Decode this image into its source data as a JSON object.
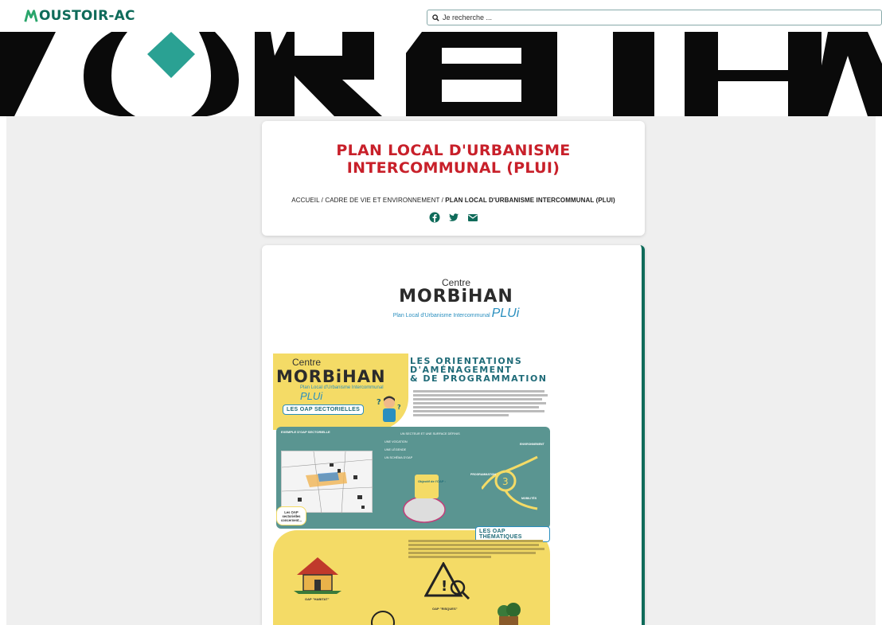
{
  "header": {
    "logo_text": "OUSTOIR-AC",
    "search_placeholder": "Je recherche ..."
  },
  "banner": {
    "text": "MORBIHA"
  },
  "page": {
    "title": "PLAN LOCAL D'URBANISME INTERCOMMUNAL (PLUI)",
    "breadcrumb": {
      "home": "ACCUEIL",
      "sep1": " / ",
      "section": "CADRE DE VIE ET ENVIRONNEMENT",
      "sep2": " / ",
      "current": "PLAN LOCAL D'URBANISME INTERCOMMUNAL (PLUI)"
    },
    "share_icons": [
      "facebook-icon",
      "twitter-icon",
      "email-icon"
    ]
  },
  "content": {
    "logo": {
      "line1": "Centre",
      "line2": "MORBiHAN",
      "line3": "Plan Local d'Urbanisme Intercommunal",
      "plui": "PLUi"
    },
    "poster": {
      "logo_line1": "Centre",
      "logo_line2": "MORBiHAN",
      "logo_line3": "Plan Local d'Urbanisme Intercommunal",
      "logo_plui": "PLUi",
      "title_line1": "LES ORIENTATIONS",
      "title_line2": "D'AMÉNAGEMENT",
      "title_line3": "& DE PROGRAMMATION",
      "tag_sectorielles": "LES OAP SECTORIELLES",
      "tag_thematiques": "LES OAP THÉMATIQUES",
      "label_exemple": "EXEMPLE D'OAP SECTORIELLE",
      "label_secteur": "UN SECTEUR ET UNE SURFACE DÉFINIS",
      "label_vocation": "UNE VOCATION",
      "label_legende": "UNE LÉGENDE",
      "label_schema": "UN SCHÉMA D'OAP",
      "label_objectif": "Objectif de l'OAP :",
      "label_environnement": "ENVIRONNEMENT",
      "label_programmation": "PROGRAMMATION",
      "label_mobilites": "MOBILITÉS",
      "label_concernent": "Les OAP sectorielles concernent...",
      "label_habitat": "OAP \"HABITAT\"",
      "label_risques": "OAP \"RISQUES\""
    }
  },
  "colors": {
    "brand_green": "#0f6b5a",
    "title_red": "#c8202a",
    "poster_yellow": "#f4db66",
    "poster_teal": "#5a9591",
    "poster_blue": "#2a8fbf"
  }
}
